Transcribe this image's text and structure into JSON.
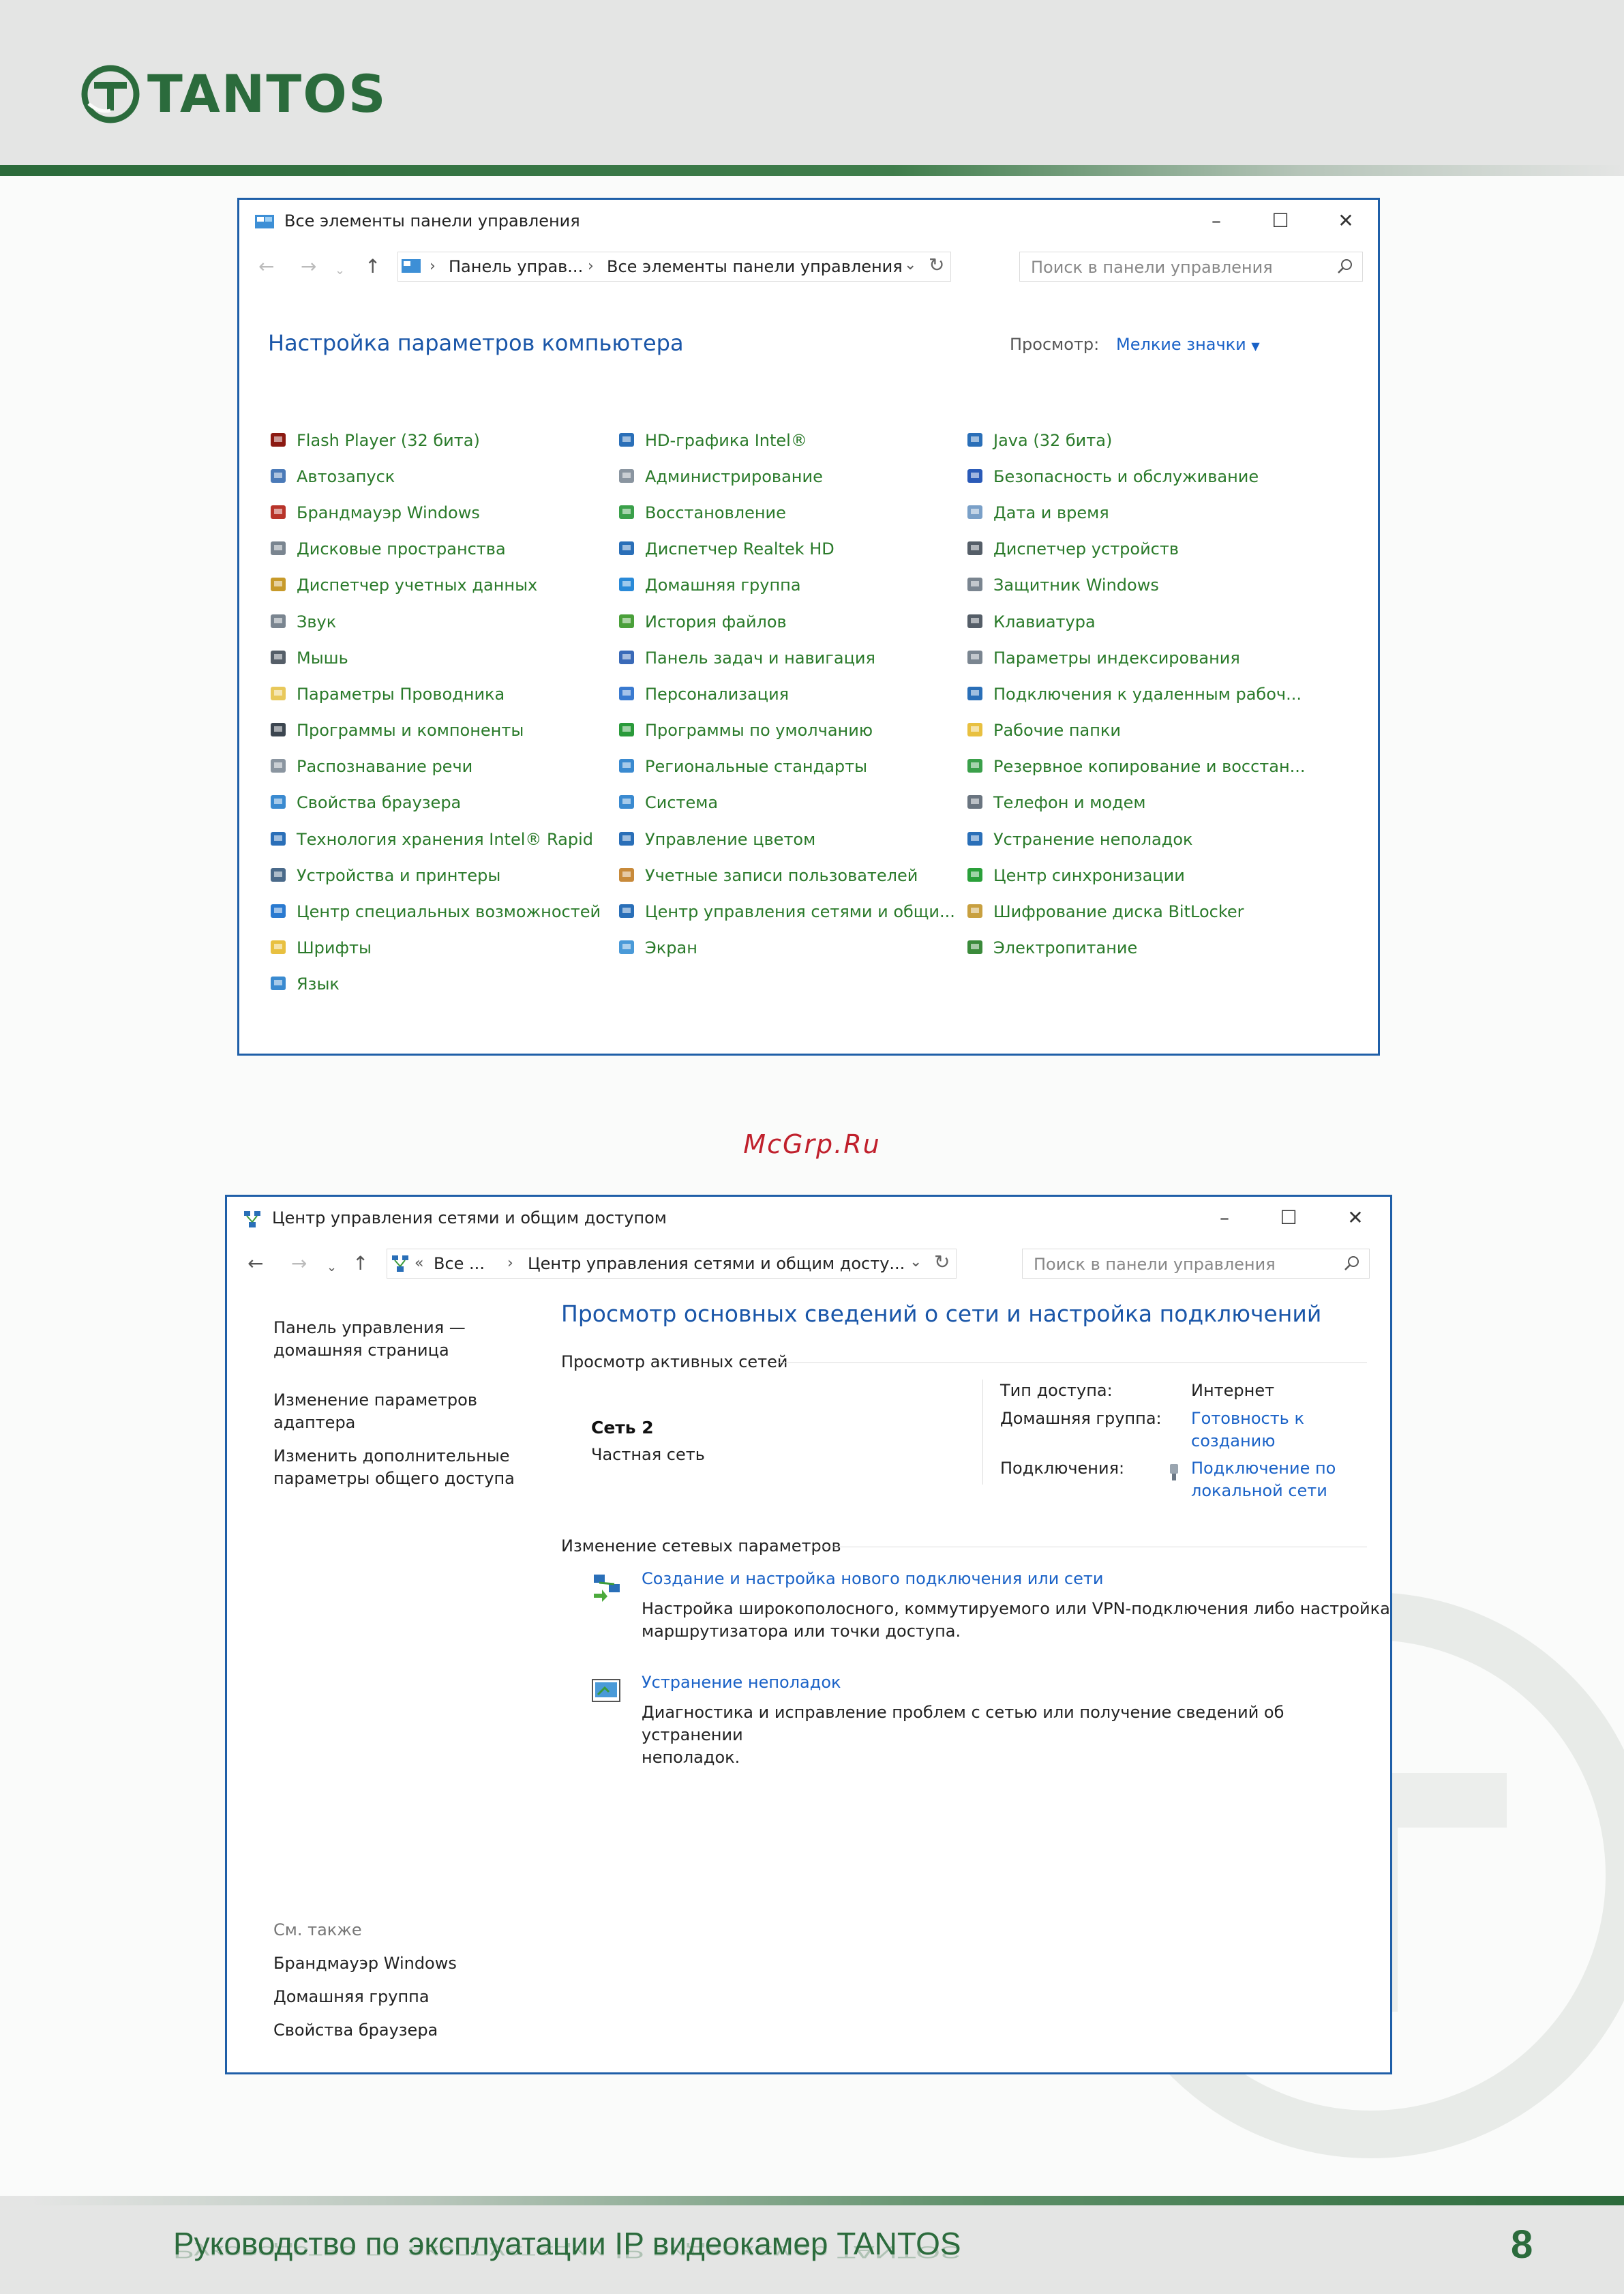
{
  "brand": {
    "logo_text": "TANTOS",
    "color_primary": "#2b6b3c"
  },
  "watermark_text": "McGrp.Ru",
  "footer": {
    "title": "Руководство по эксплуатации IP видеокамер TANTOS",
    "page_number": "8"
  },
  "window1": {
    "title": "Все элементы панели управления",
    "search_placeholder": "Поиск в панели управления",
    "breadcrumb": [
      "Панель управ...",
      "Все элементы панели управления"
    ],
    "heading": "Настройка параметров компьютера",
    "view_label": "Просмотр:",
    "view_value": "Мелкие значки",
    "columns": [
      [
        {
          "label": "Flash Player (32 бита)",
          "icon": "flash-icon"
        },
        {
          "label": "Автозапуск",
          "icon": "autoplay-icon"
        },
        {
          "label": "Брандмауэр Windows",
          "icon": "firewall-icon"
        },
        {
          "label": "Дисковые пространства",
          "icon": "storage-spaces-icon"
        },
        {
          "label": "Диспетчер учетных данных",
          "icon": "credential-manager-icon"
        },
        {
          "label": "Звук",
          "icon": "speaker-icon"
        },
        {
          "label": "Мышь",
          "icon": "mouse-icon"
        },
        {
          "label": "Параметры Проводника",
          "icon": "folder-options-icon"
        },
        {
          "label": "Программы и компоненты",
          "icon": "programs-icon"
        },
        {
          "label": "Распознавание речи",
          "icon": "microphone-icon"
        },
        {
          "label": "Свойства браузера",
          "icon": "internet-options-icon"
        },
        {
          "label": "Технология хранения Intel® Rapid",
          "icon": "intel-rapid-icon"
        },
        {
          "label": "Устройства и принтеры",
          "icon": "printer-icon"
        },
        {
          "label": "Центр специальных возможностей",
          "icon": "accessibility-icon"
        },
        {
          "label": "Шрифты",
          "icon": "fonts-icon"
        },
        {
          "label": "Язык",
          "icon": "language-icon"
        }
      ],
      [
        {
          "label": "HD-графика Intel®",
          "icon": "intel-graphics-icon"
        },
        {
          "label": "Администрирование",
          "icon": "admin-tools-icon"
        },
        {
          "label": "Восстановление",
          "icon": "recovery-icon"
        },
        {
          "label": "Диспетчер Realtek HD",
          "icon": "realtek-icon"
        },
        {
          "label": "Домашняя группа",
          "icon": "homegroup-icon"
        },
        {
          "label": "История файлов",
          "icon": "file-history-icon"
        },
        {
          "label": "Панель задач и навигация",
          "icon": "taskbar-icon"
        },
        {
          "label": "Персонализация",
          "icon": "personalization-icon"
        },
        {
          "label": "Программы по умолчанию",
          "icon": "default-programs-icon"
        },
        {
          "label": "Региональные стандарты",
          "icon": "region-icon"
        },
        {
          "label": "Система",
          "icon": "system-icon"
        },
        {
          "label": "Управление цветом",
          "icon": "color-management-icon"
        },
        {
          "label": "Учетные записи пользователей",
          "icon": "user-accounts-icon"
        },
        {
          "label": "Центр управления сетями и общи...",
          "icon": "network-center-icon"
        },
        {
          "label": "Экран",
          "icon": "display-icon"
        }
      ],
      [
        {
          "label": "Java (32 бита)",
          "icon": "java-icon"
        },
        {
          "label": "Безопасность и обслуживание",
          "icon": "security-flag-icon"
        },
        {
          "label": "Дата и время",
          "icon": "clock-icon"
        },
        {
          "label": "Диспетчер устройств",
          "icon": "device-manager-icon"
        },
        {
          "label": "Защитник Windows",
          "icon": "defender-icon"
        },
        {
          "label": "Клавиатура",
          "icon": "keyboard-icon"
        },
        {
          "label": "Параметры индексирования",
          "icon": "indexing-icon"
        },
        {
          "label": "Подключения к удаленным рабоч...",
          "icon": "remote-desktop-icon"
        },
        {
          "label": "Рабочие папки",
          "icon": "work-folders-icon"
        },
        {
          "label": "Резервное копирование и восстан...",
          "icon": "backup-icon"
        },
        {
          "label": "Телефон и модем",
          "icon": "phone-modem-icon"
        },
        {
          "label": "Устранение неполадок",
          "icon": "troubleshoot-icon"
        },
        {
          "label": "Центр синхронизации",
          "icon": "sync-icon"
        },
        {
          "label": "Шифрование диска BitLocker",
          "icon": "bitlocker-icon"
        },
        {
          "label": "Электропитание",
          "icon": "power-icon"
        }
      ]
    ]
  },
  "window2": {
    "title": "Центр управления сетями и общим доступом",
    "search_placeholder": "Поиск в панели управления",
    "breadcrumb_prefix": "«",
    "breadcrumb": [
      "Все ...",
      "Центр управления сетями и общим досту..."
    ],
    "left_links": [
      [
        "Панель управления —",
        "домашняя страница"
      ],
      [
        "Изменение параметров",
        "адаптера"
      ],
      [
        "Изменить дополнительные",
        "параметры общего доступа"
      ]
    ],
    "see_also_label": "См. также",
    "see_also": [
      "Брандмауэр Windows",
      "Домашняя группа",
      "Свойства браузера"
    ],
    "heading": "Просмотр основных сведений о сети и настройка подключений",
    "active_networks_label": "Просмотр активных сетей",
    "network": {
      "name": "Сеть 2",
      "type": "Частная сеть",
      "access_type_label": "Тип доступа:",
      "access_type": "Интернет",
      "homegroup_label": "Домашняя группа:",
      "homegroup_value": [
        "Готовность к",
        "созданию"
      ],
      "connections_label": "Подключения:",
      "connection_value": [
        "Подключение по",
        "локальной сети"
      ]
    },
    "change_settings_label": "Изменение сетевых параметров",
    "tasks": [
      {
        "link": "Создание и настройка нового подключения или сети",
        "desc": [
          "Настройка широкополосного, коммутируемого или VPN-подключения либо настройка",
          "маршрутизатора или точки доступа."
        ],
        "icon": "new-connection-icon"
      },
      {
        "link": "Устранение неполадок",
        "desc": [
          "Диагностика и исправление проблем с сетью или получение сведений об устранении",
          "неполадок."
        ],
        "icon": "troubleshoot-icon"
      }
    ]
  }
}
